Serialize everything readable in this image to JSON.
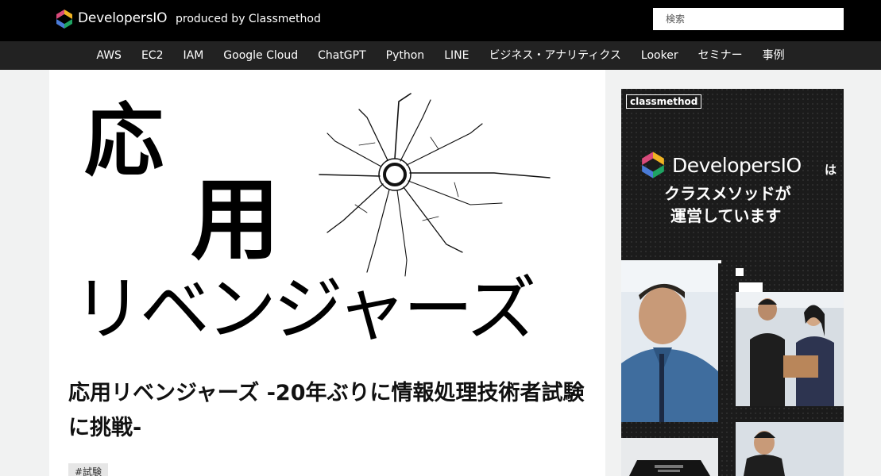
{
  "header": {
    "brand": "DevelopersIO",
    "produced_by": "produced by Classmethod",
    "search_placeholder": "検索"
  },
  "nav": {
    "items": [
      "AWS",
      "EC2",
      "IAM",
      "Google Cloud",
      "ChatGPT",
      "Python",
      "LINE",
      "ビジネス・アナリティクス",
      "Looker",
      "セミナー",
      "事例"
    ]
  },
  "article": {
    "hero": {
      "line1": "応",
      "line2": "用",
      "line3": "リベンジャーズ"
    },
    "title": "応用リベンジャーズ -20年ぶりに情報処理技術者試験に挑戦-",
    "tag": "#試験"
  },
  "ad": {
    "badge": "classmethod",
    "brand": "DevelopersIO",
    "particle": "は",
    "line2": "クラスメソッドが",
    "line3": "運営しています"
  },
  "colors": {
    "header_bg": "#000000",
    "nav_bg": "#222222",
    "page_bg": "#f1f2f2",
    "ad_bg": "#1b1b1b"
  }
}
